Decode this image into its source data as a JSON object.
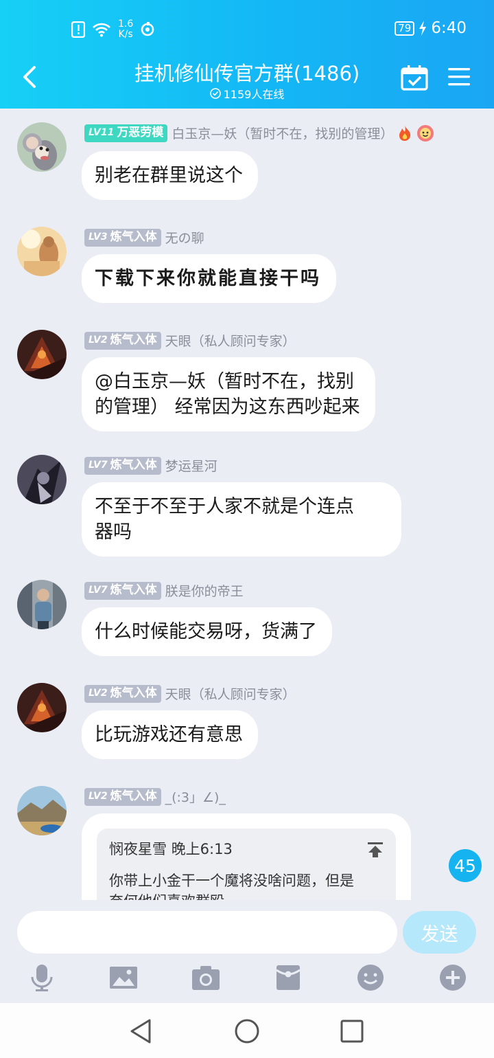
{
  "status_bar": {
    "net_speed_value": "1.6",
    "net_speed_unit": "K/s",
    "battery": "79",
    "time": "6:40"
  },
  "header": {
    "title": "挂机修仙传官方群(1486)",
    "online": "1159人在线"
  },
  "messages": [
    {
      "level": "LV11",
      "rank": "万恶劳模",
      "sender": "白玉京—妖（暂时不在，找别的管理）",
      "text": "别老在群里说这个"
    },
    {
      "level": "LV3",
      "rank": "炼气入体",
      "sender": "无の聊",
      "text": "下载下来你就能直接干吗"
    },
    {
      "level": "LV2",
      "rank": "炼气入体",
      "sender": "天眼（私人顾问专家）",
      "text_line1": "@白玉京—妖（暂时不在，找别",
      "text_line2": "的管理） 经常因为这东西吵起来"
    },
    {
      "level": "LV7",
      "rank": "炼气入体",
      "sender": "梦运星河",
      "text_line1": "不至于不至于人家不就是个连点",
      "text_line2": "器吗"
    },
    {
      "level": "LV7",
      "rank": "炼气入体",
      "sender": "朕是你的帝王",
      "text": "什么时候能交易呀，货满了"
    },
    {
      "level": "LV2",
      "rank": "炼气入体",
      "sender": "天眼（私人顾问专家）",
      "text": "比玩游戏还有意思"
    },
    {
      "level": "LV2",
      "rank": "炼气入体",
      "sender": "_(:3」∠)_",
      "reply": {
        "author": "悯夜星雪",
        "time": "晚上6:13",
        "text_line1": "你带上小金干一个魔将没啥问题，但是",
        "text_line2": "奈何他们喜欢群殴"
      }
    }
  ],
  "new_message_count": "45",
  "input": {
    "placeholder": "",
    "send_label": "发送"
  },
  "toolbar_icons": [
    "mic-icon",
    "image-icon",
    "camera-icon",
    "red-packet-icon",
    "emoji-icon",
    "plus-icon"
  ],
  "colors": {
    "header_start": "#16d0f6",
    "header_end": "#1aa6f3",
    "chat_bg": "#ebedf5",
    "badge_gold": "#3ed7c2",
    "badge_grey": "#b6bccb"
  }
}
